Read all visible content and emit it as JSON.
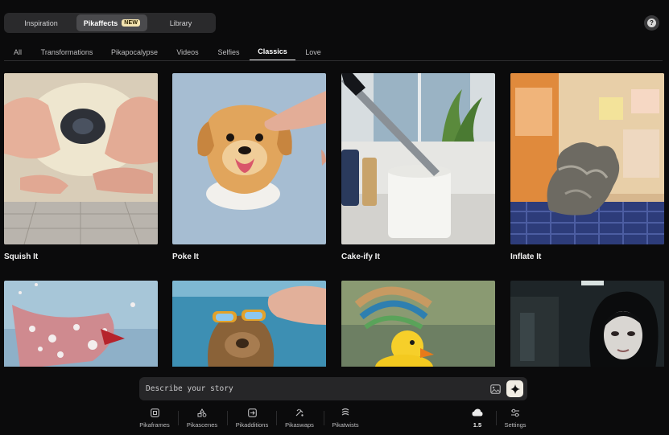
{
  "top_tabs": [
    {
      "label": "Inspiration"
    },
    {
      "label": "Pikaffects",
      "badge": "NEW"
    },
    {
      "label": "Library"
    }
  ],
  "help": {
    "label": "?"
  },
  "categories": [
    "All",
    "Transformations",
    "Pikapocalypse",
    "Videos",
    "Selfies",
    "Classics",
    "Love"
  ],
  "active_category": "Classics",
  "cards": [
    {
      "title": "Squish It"
    },
    {
      "title": "Poke It"
    },
    {
      "title": "Cake-ify It"
    },
    {
      "title": "Inflate It"
    },
    {
      "title": ""
    },
    {
      "title": ""
    },
    {
      "title": ""
    },
    {
      "title": ""
    }
  ],
  "prompt": {
    "placeholder": "Describe your story"
  },
  "toolbar": [
    {
      "label": "Pikaframes",
      "icon": "frame-icon"
    },
    {
      "label": "Pikascenes",
      "icon": "scenes-icon"
    },
    {
      "label": "Pikadditions",
      "icon": "additions-icon"
    },
    {
      "label": "Pikaswaps",
      "icon": "swap-icon"
    },
    {
      "label": "Pikatwists",
      "icon": "twist-icon"
    }
  ],
  "model": {
    "label": "1.5",
    "icon": "cloud-icon"
  },
  "settings": {
    "label": "Settings",
    "icon": "sliders-icon"
  },
  "colors": {
    "background": "#0b0b0c",
    "badge": "#f4e4b0",
    "generate_button": "#f1ede4"
  }
}
